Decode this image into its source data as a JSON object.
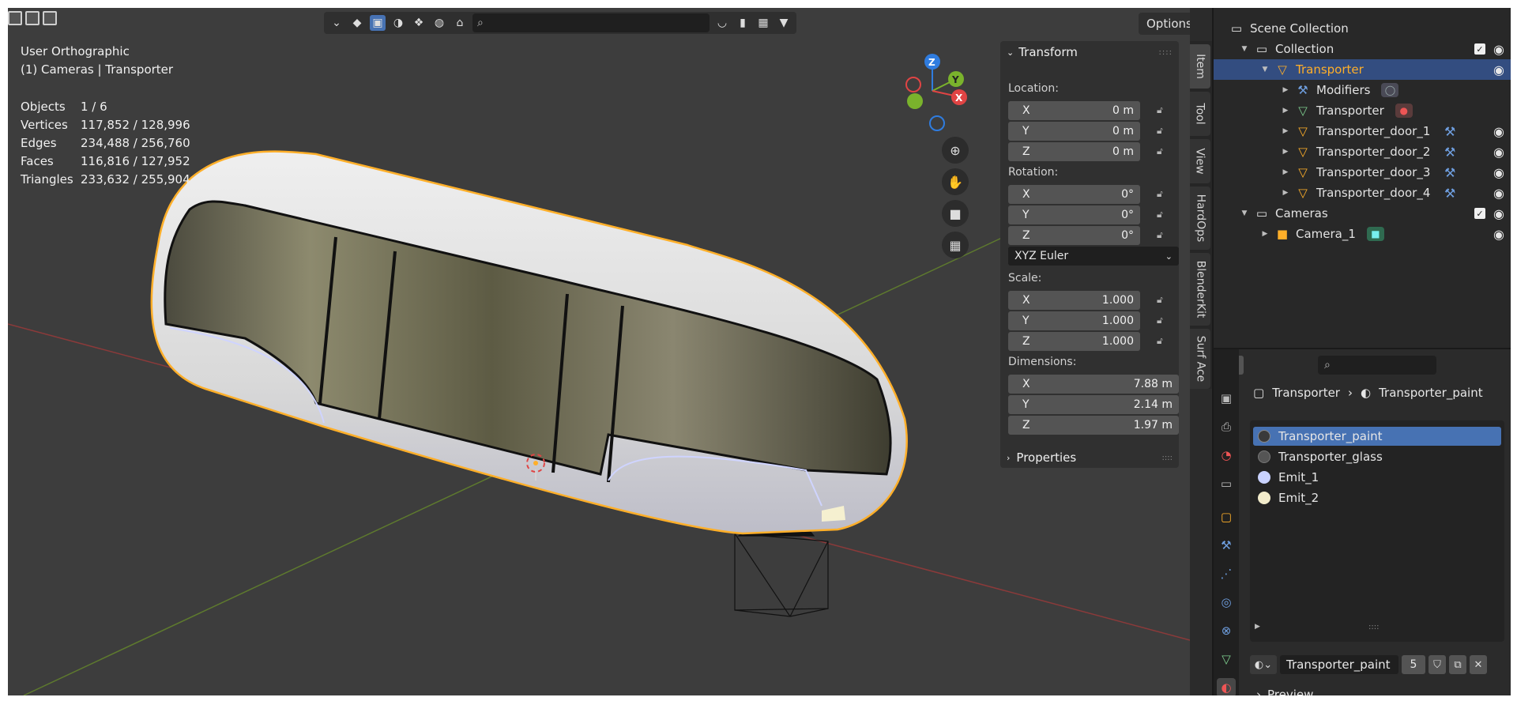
{
  "viewport": {
    "view_name": "User Orthographic",
    "context": "(1) Cameras | Transporter",
    "stats": [
      {
        "key": "Objects",
        "value": "1 / 6"
      },
      {
        "key": "Vertices",
        "value": "117,852 / 128,996"
      },
      {
        "key": "Edges",
        "value": "234,488 / 256,760"
      },
      {
        "key": "Faces",
        "value": "116,816 / 127,952"
      },
      {
        "key": "Triangles",
        "value": "233,632 / 255,904"
      }
    ],
    "options_label": "Options",
    "gizmo": {
      "z": "Z",
      "y": "Y",
      "x": "X"
    }
  },
  "npanel": {
    "transform_title": "Transform",
    "location_label": "Location:",
    "location": [
      {
        "axis": "X",
        "value": "0 m"
      },
      {
        "axis": "Y",
        "value": "0 m"
      },
      {
        "axis": "Z",
        "value": "0 m"
      }
    ],
    "rotation_label": "Rotation:",
    "rotation": [
      {
        "axis": "X",
        "value": "0°"
      },
      {
        "axis": "Y",
        "value": "0°"
      },
      {
        "axis": "Z",
        "value": "0°"
      }
    ],
    "rotation_mode": "XYZ Euler",
    "scale_label": "Scale:",
    "scale": [
      {
        "axis": "X",
        "value": "1.000"
      },
      {
        "axis": "Y",
        "value": "1.000"
      },
      {
        "axis": "Z",
        "value": "1.000"
      }
    ],
    "dimensions_label": "Dimensions:",
    "dimensions": [
      {
        "axis": "X",
        "value": "7.88 m"
      },
      {
        "axis": "Y",
        "value": "2.14 m"
      },
      {
        "axis": "Z",
        "value": "1.97 m"
      }
    ],
    "properties_title": "Properties",
    "tabs": [
      "Item",
      "Tool",
      "View",
      "HardOps",
      "BlenderKit",
      "Surf Ace"
    ]
  },
  "outliner": {
    "scene_collection": "Scene Collection",
    "collection": "Collection",
    "transporter": "Transporter",
    "modifiers": "Modifiers",
    "transporter_mesh": "Transporter",
    "doors": [
      "Transporter_door_1",
      "Transporter_door_2",
      "Transporter_door_3",
      "Transporter_door_4"
    ],
    "cameras": "Cameras",
    "camera_1": "Camera_1"
  },
  "properties": {
    "crumb_object": "Transporter",
    "crumb_material": "Transporter_paint",
    "materials": [
      {
        "name": "Transporter_paint",
        "color": "#3a3a3a"
      },
      {
        "name": "Transporter_glass",
        "color": "#555555"
      },
      {
        "name": "Emit_1",
        "color": "#c9d2ff"
      },
      {
        "name": "Emit_2",
        "color": "#f2eccb"
      }
    ],
    "active_material": "Transporter_paint",
    "users": "5",
    "preview_label": "Preview"
  },
  "colors": {
    "selection_orange": "#ffaf29",
    "active_blue": "#4772b3",
    "x_axis_red": "#e04444",
    "y_axis_green": "#7ab32c",
    "z_axis_blue": "#2f7cdf"
  }
}
